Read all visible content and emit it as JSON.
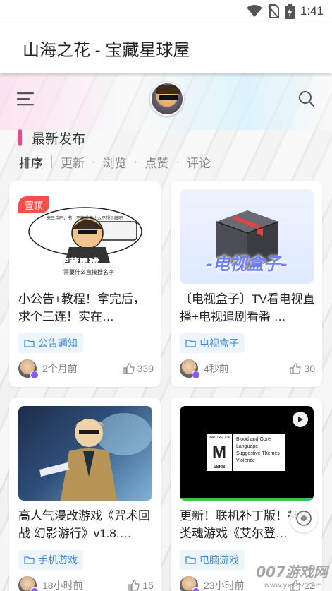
{
  "status": {
    "time": "1:41",
    "icons": [
      "wifi-icon",
      "no-sim-icon",
      "battery-charging-icon"
    ]
  },
  "app_title": "山海之花 - 宝藏星球屋",
  "header": {
    "menu_icon": "menu-icon",
    "search_icon": "search-icon"
  },
  "section": {
    "title": "最新发布",
    "accent": "#e74b8c"
  },
  "sort": {
    "active": "排序",
    "options": [
      "更新",
      "浏览",
      "点赞",
      "评论"
    ]
  },
  "cards": [
    {
      "pinned_label": "置顶",
      "thumb_text_top": "来三连吧，书：不知道有什么不想了解吧",
      "thumb_text_brand": "宝藏星球",
      "thumb_text_sub": "需要什么直接搜名字",
      "title": "小公告+教程！拿完后，求个三连！实在…",
      "tag": "公告通知",
      "time": "2个月前",
      "likes": "339"
    },
    {
      "thumb_caption": "-电视盒子-",
      "title": "〔电视盒子〕TV看电视直播+电视追剧看番 …",
      "tag": "电视盒子",
      "time": "4秒前",
      "likes": "30"
    },
    {
      "title": "高人气漫改游戏《咒术回战 幻影游行》v1.8.…",
      "tag": "手机游戏",
      "time": "18小时前",
      "likes": "15"
    },
    {
      "rating_letter": "M",
      "rating_top": "MATURE 17+",
      "rating_bottom": "ESRB",
      "rating_lines": [
        "Blood and Gore",
        "Language",
        "Suggestive Themes",
        "Violence"
      ],
      "title": "更新！联机补丁版！神作类魂游戏《艾尔登…",
      "tag": "电脑游戏",
      "time": "23小时前",
      "likes": "12"
    }
  ],
  "watermark": {
    "main": "007游戏网",
    "sub": "www.yx007.com"
  },
  "colors": {
    "tag_text": "#3f8ae0",
    "tag_bg": "#edf5fe",
    "pin_bg": "#f2504a"
  }
}
